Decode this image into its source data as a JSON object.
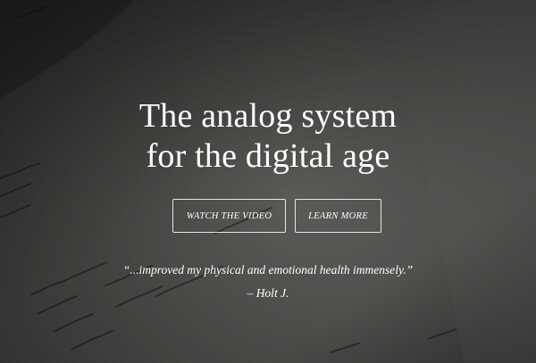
{
  "hero": {
    "headline_line1": "The analog system",
    "headline_line2": "for the digital age"
  },
  "buttons": {
    "watch_video": "WATCH THE VIDEO",
    "learn_more": "LEARN MORE"
  },
  "testimonial": {
    "quote": "“...improved my physical and emotional health immensely.”",
    "author": "– Holt J."
  },
  "colors": {
    "text": "#ffffff",
    "background": "#4a4a48"
  }
}
